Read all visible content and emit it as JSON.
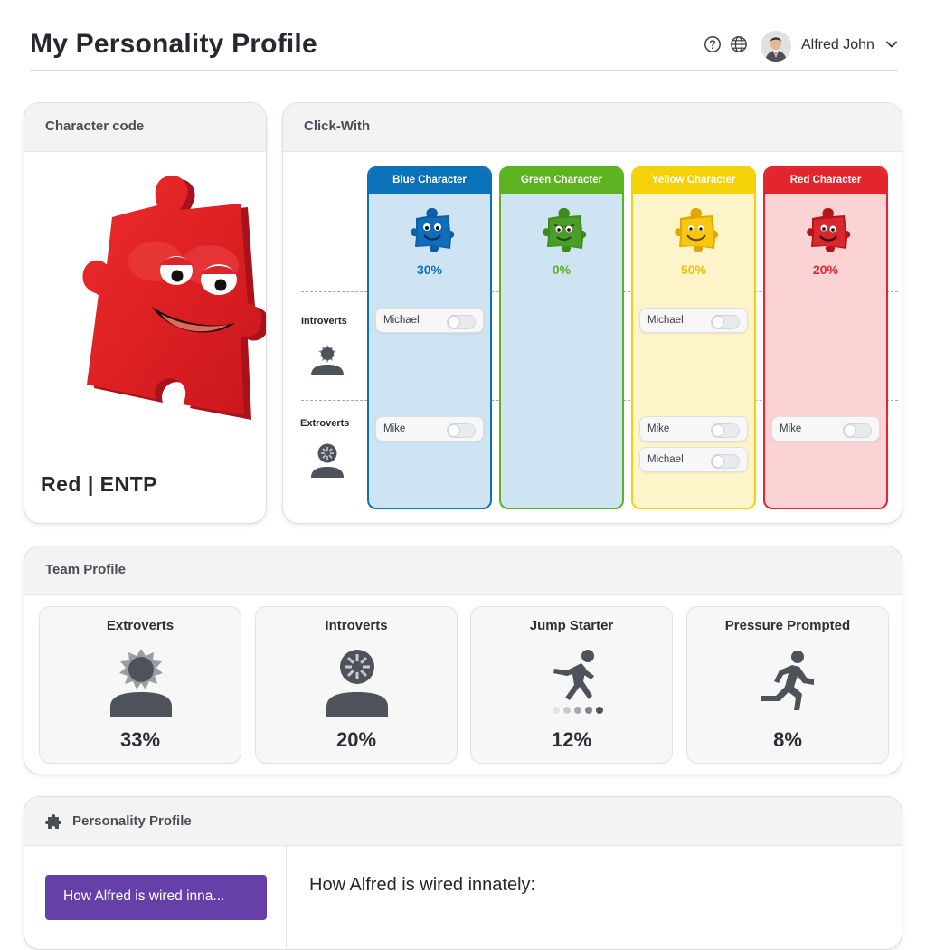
{
  "header": {
    "title": "My Personality Profile",
    "user_name": "Alfred John",
    "icons": [
      "help-icon",
      "globe-icon",
      "chevron-down-icon"
    ]
  },
  "character_card": {
    "title": "Character code",
    "code": "Red | ENTP"
  },
  "click_with": {
    "title": "Click-With",
    "rows": [
      "Introverts",
      "Extroverts"
    ],
    "columns": [
      {
        "name": "Blue Character",
        "percent": "30%",
        "color": "#0b72b9",
        "bg": "#cfe4f2",
        "introverts": [
          "Michael"
        ],
        "extroverts": [
          "Mike"
        ]
      },
      {
        "name": "Green Character",
        "percent": "0%",
        "color": "#5cb21f",
        "bg": "#cfe4f2",
        "introverts": [],
        "extroverts": []
      },
      {
        "name": "Yellow Character",
        "percent": "50%",
        "color": "#f5d10a",
        "bg": "#fdf5c9",
        "introverts": [
          "Michael"
        ],
        "extroverts": [
          "Mike",
          "Michael"
        ]
      },
      {
        "name": "Red Character",
        "percent": "20%",
        "color": "#e3262d",
        "bg": "#fbd3d4",
        "introverts": [],
        "extroverts": [
          "Mike"
        ]
      }
    ]
  },
  "team_profile": {
    "title": "Team Profile",
    "stats": [
      {
        "title": "Extroverts",
        "value": "33%",
        "icon": "extrovert-person-icon"
      },
      {
        "title": "Introverts",
        "value": "20%",
        "icon": "introvert-person-icon"
      },
      {
        "title": "Jump Starter",
        "value": "12%",
        "icon": "jump-starter-icon"
      },
      {
        "title": "Pressure Prompted",
        "value": "8%",
        "icon": "running-person-icon"
      }
    ]
  },
  "personality_profile": {
    "title": "Personality Profile",
    "button_label": "How Alfred is wired inna...",
    "heading": "How Alfred is wired innately:"
  },
  "colors": {
    "accent_purple": "#6440a8",
    "text_dark": "#25282d",
    "icon_gray": "#4d525b"
  }
}
